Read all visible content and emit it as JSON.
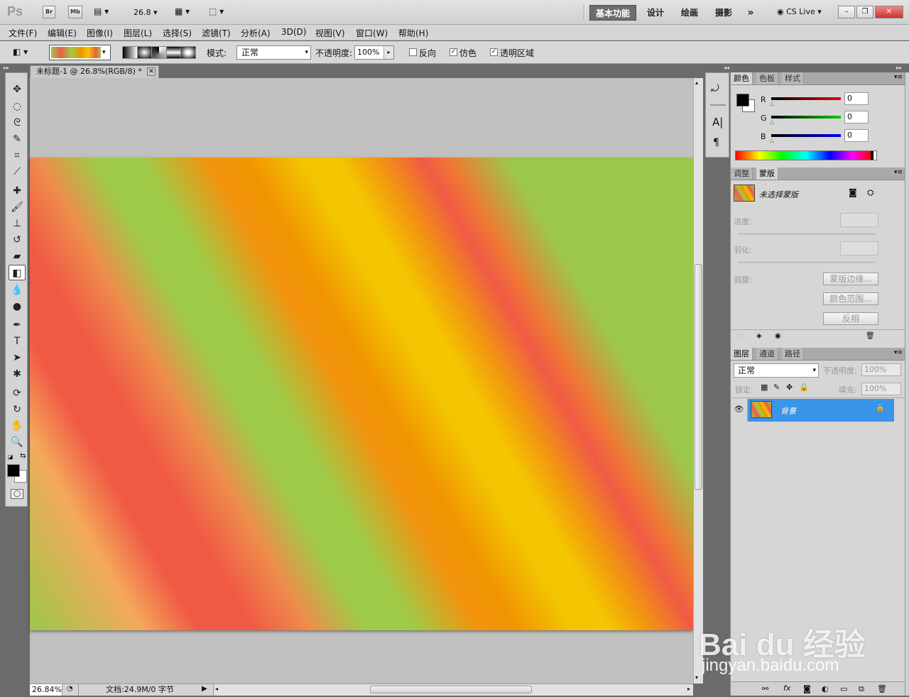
{
  "app": {
    "logo": "Ps",
    "br": "Br",
    "mb": "Mb",
    "zoom_value": "26.8"
  },
  "workspaces": [
    "基本功能",
    "设计",
    "绘画",
    "摄影"
  ],
  "cs_live": "CS Live",
  "menu": [
    "文件(F)",
    "编辑(E)",
    "图像(I)",
    "图层(L)",
    "选择(S)",
    "滤镜(T)",
    "分析(A)",
    "3D(D)",
    "视图(V)",
    "窗口(W)",
    "帮助(H)"
  ],
  "options": {
    "mode_label": "模式:",
    "mode_value": "正常",
    "opacity_label": "不透明度:",
    "opacity_value": "100%",
    "reverse_label": "反向",
    "reverse_checked": false,
    "dither_label": "仿色",
    "dither_checked": true,
    "transparency_label": "透明区域",
    "transparency_checked": true
  },
  "document": {
    "tab_title": "未标题-1 @ 26.8%(RGB/8) *",
    "zoom_status": "26.84%",
    "doc_info": "文档:24.9M/0 字节"
  },
  "color_panel": {
    "tabs": [
      "颜色",
      "色板",
      "样式"
    ],
    "channels": [
      {
        "label": "R",
        "value": "0",
        "color": "#cc0000"
      },
      {
        "label": "G",
        "value": "0",
        "color": "#00aa00"
      },
      {
        "label": "B",
        "value": "0",
        "color": "#0000cc"
      }
    ]
  },
  "masks_panel": {
    "tabs": [
      "调整",
      "蒙版"
    ],
    "title": "未选择蒙版",
    "density_label": "浓度:",
    "feather_label": "羽化:",
    "refine_label": "调整:",
    "buttons": [
      "蒙版边缘...",
      "颜色范围...",
      "反相"
    ]
  },
  "layers_panel": {
    "tabs": [
      "图层",
      "通道",
      "路径"
    ],
    "blend_mode": "正常",
    "opacity_label": "不透明度:",
    "opacity_value": "100%",
    "lock_label": "锁定:",
    "fill_label": "填充:",
    "fill_value": "100%",
    "layers": [
      {
        "name": "背景",
        "locked": true,
        "visible": true,
        "selected": true
      }
    ]
  },
  "watermark": {
    "brand": "Bai du 经验",
    "url": "jingyan.baidu.com"
  }
}
